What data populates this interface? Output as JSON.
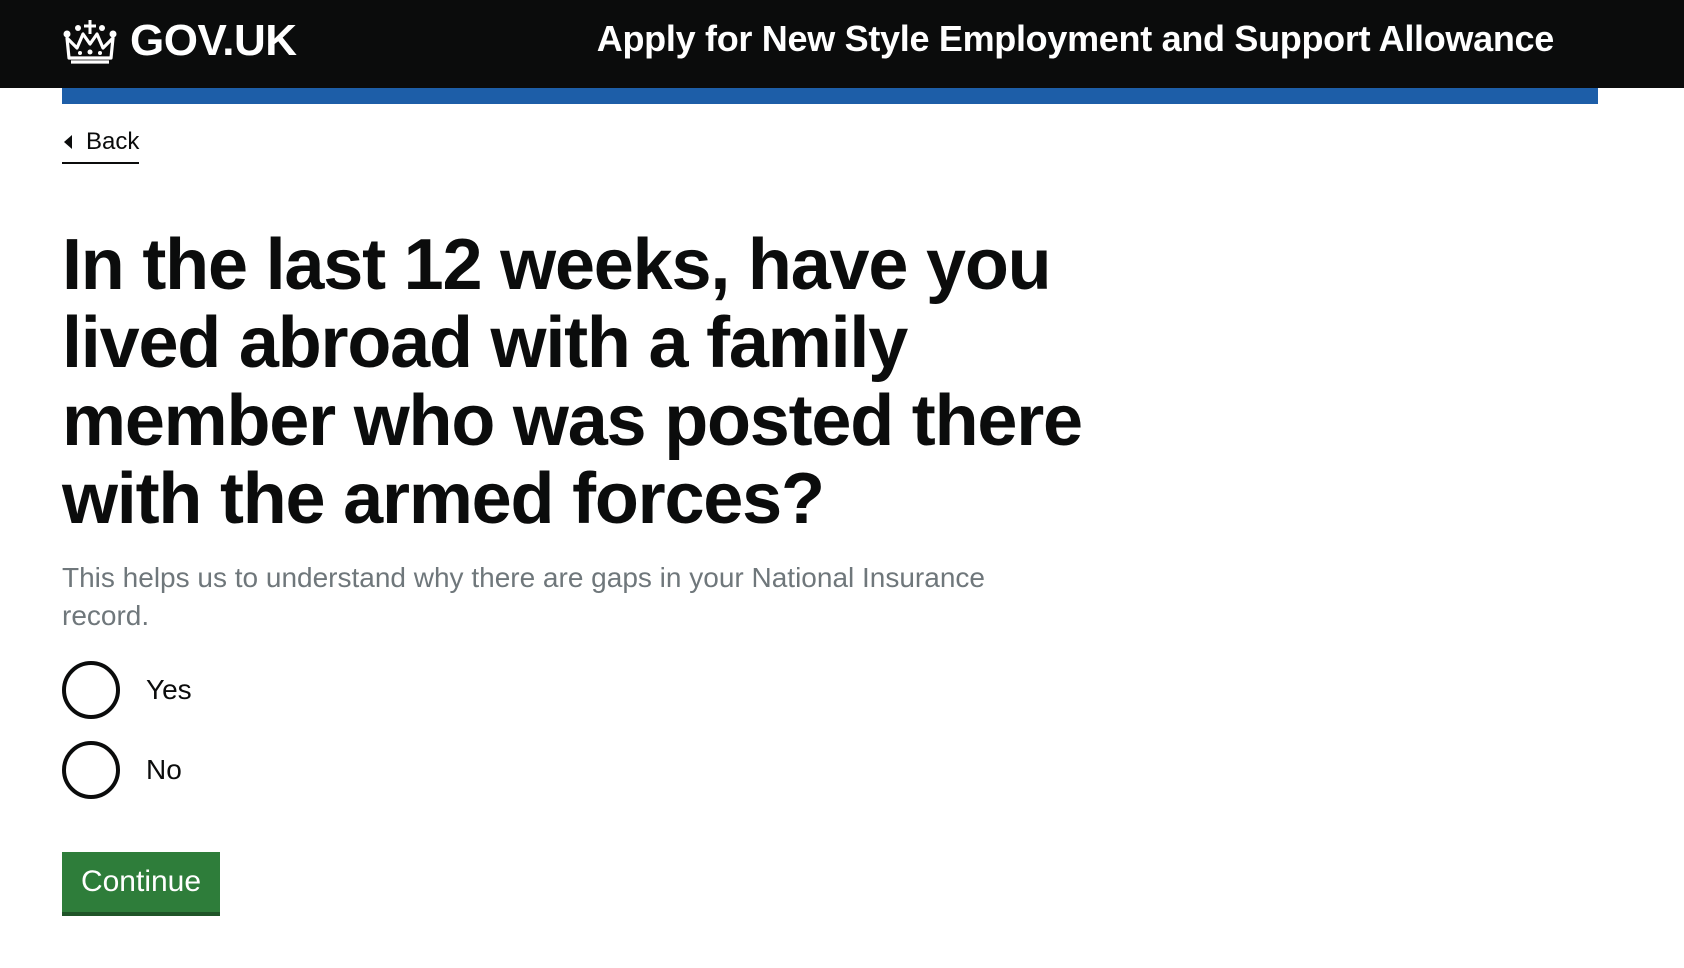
{
  "header": {
    "logo_text": "GOV.UK",
    "logo_icon": "crown-icon",
    "service_name": "Apply for New Style Employment and Support Allowance",
    "background_color": "#0b0c0c",
    "accent_bar_color": "#1d5ea8"
  },
  "navigation": {
    "back_label": "Back",
    "back_icon": "triangle-left-icon"
  },
  "question": {
    "title": "In the last 12 weeks, have you lived abroad with a family member who was posted there with the armed forces?",
    "hint": "This helps us to understand why there are gaps in your National Insurance record.",
    "options": [
      {
        "label": "Yes",
        "selected": false
      },
      {
        "label": "No",
        "selected": false
      }
    ]
  },
  "actions": {
    "continue_label": "Continue",
    "continue_color": "#2e7d3a"
  }
}
